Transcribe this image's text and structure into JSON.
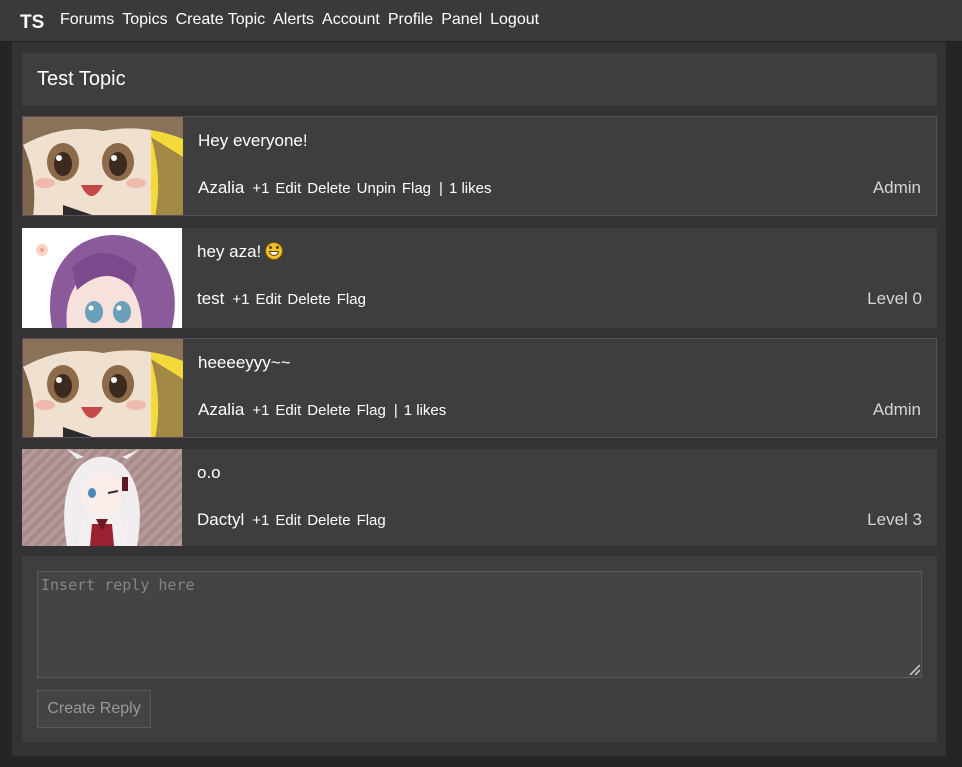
{
  "navbar": {
    "logo": "TS",
    "links": [
      {
        "label": "Forums"
      },
      {
        "label": "Topics"
      },
      {
        "label": "Create Topic"
      },
      {
        "label": "Alerts"
      },
      {
        "label": "Account"
      },
      {
        "label": "Profile"
      },
      {
        "label": "Panel"
      },
      {
        "label": "Logout"
      }
    ]
  },
  "topic": {
    "title": "Test Topic"
  },
  "posts": [
    {
      "content": "Hey everyone!",
      "username": "Azalia",
      "actions": [
        "+1",
        "Edit",
        "Delete",
        "Unpin",
        "Flag"
      ],
      "separator": "|",
      "likes": "1 likes",
      "rank": "Admin",
      "pinned": true,
      "avatar": "avatar-azalia"
    },
    {
      "content": "hey aza!",
      "emoji": "grinning-face-icon",
      "username": "test",
      "actions": [
        "+1",
        "Edit",
        "Delete",
        "Flag"
      ],
      "rank": "Level 0",
      "pinned": false,
      "avatar": "avatar-test"
    },
    {
      "content": "heeeeyyy~~",
      "username": "Azalia",
      "actions": [
        "+1",
        "Edit",
        "Delete",
        "Flag"
      ],
      "separator": "|",
      "likes": "1 likes",
      "rank": "Admin",
      "pinned": true,
      "avatar": "avatar-azalia"
    },
    {
      "content": "o.o",
      "username": "Dactyl",
      "actions": [
        "+1",
        "Edit",
        "Delete",
        "Flag"
      ],
      "rank": "Level 3",
      "pinned": false,
      "avatar": "avatar-dactyl"
    }
  ],
  "reply": {
    "placeholder": "Insert reply here",
    "button_label": "Create Reply"
  },
  "colors": {
    "page_bg": "#252525",
    "navbar_bg": "#3a3a3a",
    "container_bg": "#333333",
    "panel_bg": "#3e3e3e",
    "pinned_border": "#5f4b5f",
    "rank_text": "#d6d6d6"
  }
}
